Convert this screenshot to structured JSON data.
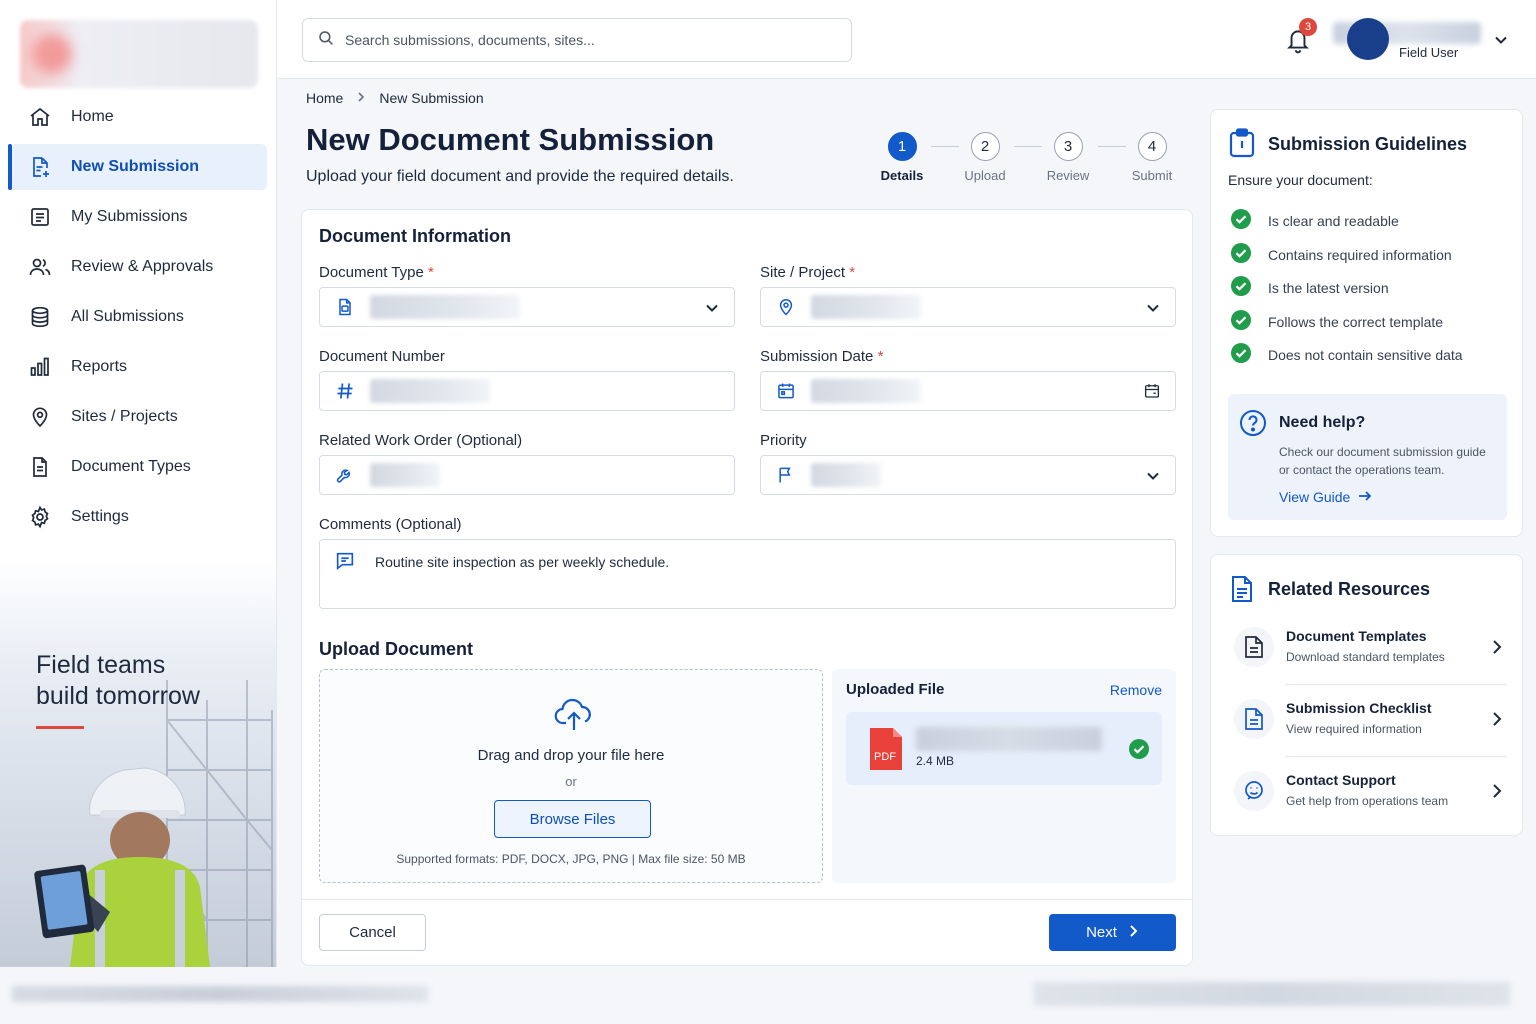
{
  "sidebar": {
    "items": [
      {
        "label": "Home",
        "icon": "home-icon"
      },
      {
        "label": "New Submission",
        "icon": "document-add-icon",
        "active": true
      },
      {
        "label": "My Submissions",
        "icon": "list-icon"
      },
      {
        "label": "Review & Approvals",
        "icon": "users-icon"
      },
      {
        "label": "All Submissions",
        "icon": "database-icon"
      },
      {
        "label": "Reports",
        "icon": "bar-chart-icon"
      },
      {
        "label": "Sites / Projects",
        "icon": "location-pin-icon"
      },
      {
        "label": "Document Types",
        "icon": "document-icon"
      },
      {
        "label": "Settings",
        "icon": "gear-icon"
      }
    ],
    "hero_line1": "Field teams",
    "hero_line2": "build tomorrow"
  },
  "topbar": {
    "search_placeholder": "Search submissions, documents, sites...",
    "notification_count": "3",
    "user_role": "Field User"
  },
  "breadcrumb": {
    "home": "Home",
    "current": "New Submission"
  },
  "page": {
    "title": "New Document Submission",
    "subtitle": "Upload your field document and provide the required details."
  },
  "stepper": [
    {
      "num": "1",
      "label": "Details",
      "active": true
    },
    {
      "num": "2",
      "label": "Upload"
    },
    {
      "num": "3",
      "label": "Review"
    },
    {
      "num": "4",
      "label": "Submit"
    }
  ],
  "form": {
    "section_title": "Document Information",
    "document_type_label": "Document Type",
    "site_project_label": "Site / Project",
    "document_number_label": "Document Number",
    "submission_date_label": "Submission Date",
    "work_order_label": "Related Work Order (Optional)",
    "priority_label": "Priority",
    "comments_label": "Comments (Optional)",
    "comments_value": "Routine site inspection as per weekly schedule.",
    "required_mark": "*"
  },
  "upload": {
    "section_title": "Upload Document",
    "drop_text": "Drag and drop your file here",
    "or_text": "or",
    "browse_label": "Browse Files",
    "note": "Supported formats: PDF, DOCX, JPG, PNG  |  Max file size: 50 MB",
    "uploaded_title": "Uploaded File",
    "remove_label": "Remove",
    "file_size": "2.4 MB",
    "file_type_label": "PDF"
  },
  "actions": {
    "cancel": "Cancel",
    "next": "Next"
  },
  "guidelines": {
    "title": "Submission Guidelines",
    "intro": "Ensure your document:",
    "items": [
      "Is clear and readable",
      "Contains required information",
      "Is the latest version",
      "Follows the correct template",
      "Does not contain sensitive data"
    ],
    "help_title": "Need help?",
    "help_text": "Check our document submission guide or contact the operations team.",
    "help_link": "View Guide"
  },
  "resources": {
    "title": "Related Resources",
    "items": [
      {
        "title": "Document Templates",
        "subtitle": "Download standard templates"
      },
      {
        "title": "Submission Checklist",
        "subtitle": "View required information"
      },
      {
        "title": "Contact Support",
        "subtitle": "Get help from operations team"
      }
    ]
  },
  "colors": {
    "primary": "#1259c9",
    "success": "#1f9d4a",
    "danger": "#e0473c"
  }
}
